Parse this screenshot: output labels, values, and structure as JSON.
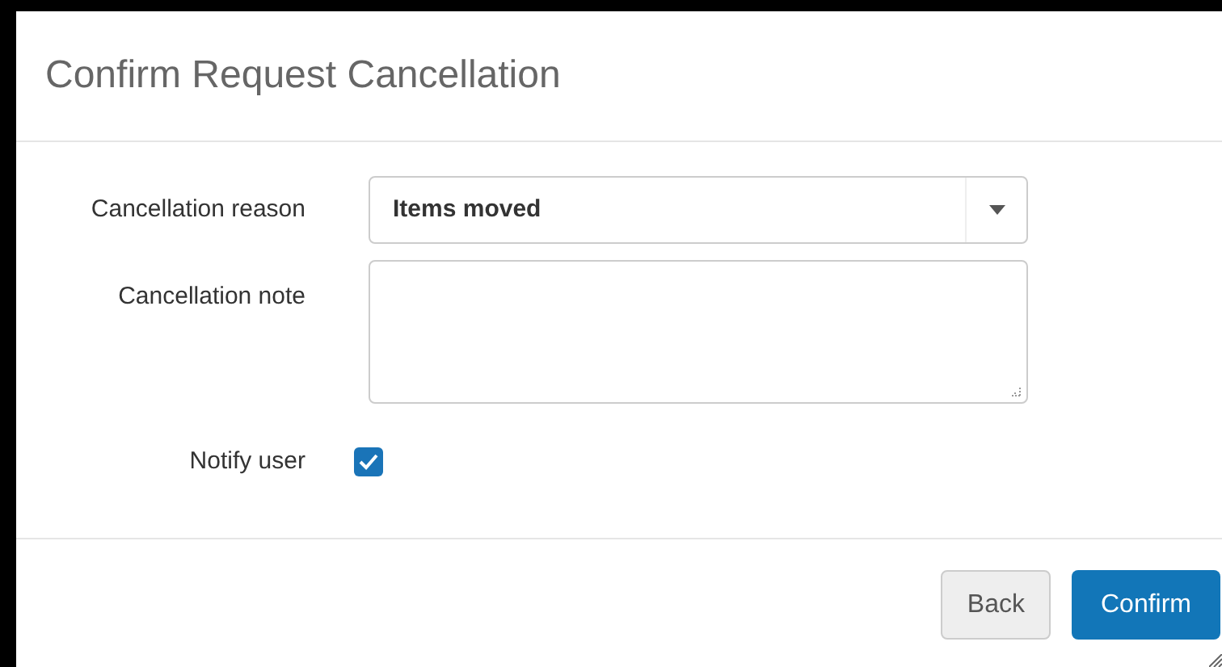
{
  "dialog": {
    "title": "Confirm Request Cancellation"
  },
  "fields": [
    {
      "kind": "select",
      "label": "Cancellation reason",
      "value": "Items moved"
    },
    {
      "kind": "textarea",
      "label": "Cancellation note"
    },
    {
      "kind": "checkbox",
      "label": "Notify user",
      "checked": true
    }
  ],
  "buttons": [
    {
      "label": "Back",
      "kind": "secondary"
    },
    {
      "label": "Confirm",
      "kind": "primary"
    }
  ]
}
